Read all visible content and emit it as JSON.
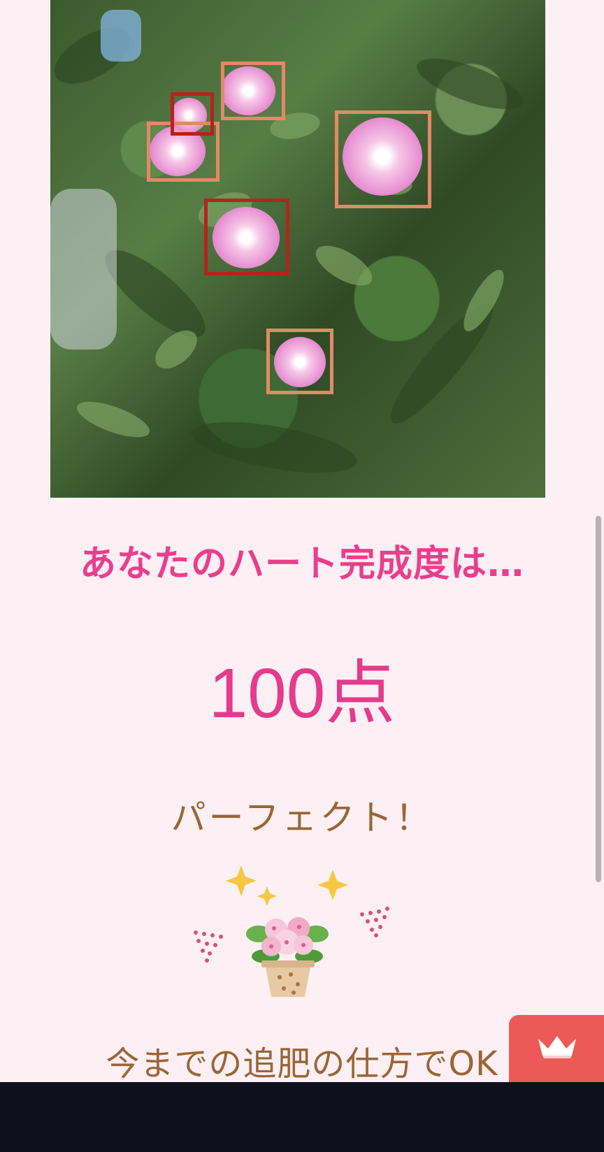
{
  "result": {
    "heading": "あなたのハート完成度は…",
    "score": "100点",
    "verdict": "パーフェクト！",
    "advice": "今までの追肥の仕方でOK"
  },
  "colors": {
    "background": "#fcf0f4",
    "heading": "#ea3e8c",
    "score": "#e43b8c",
    "body_text": "#9b6536",
    "fab": "#eb5a57",
    "nav_bar": "#0e111c"
  },
  "icons": {
    "fab_icon": "crown-icon",
    "illustration": "flower-pot-sparkle-illustration"
  }
}
